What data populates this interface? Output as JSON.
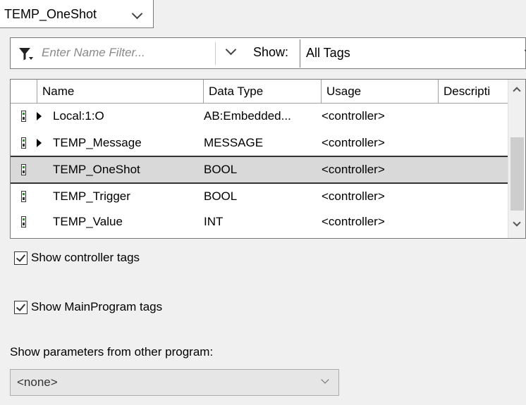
{
  "tag_combo": {
    "value": "TEMP_OneShot"
  },
  "filter": {
    "placeholder": "Enter Name Filter...",
    "show_label": "Show:",
    "show_value": "All Tags"
  },
  "grid": {
    "columns": [
      "Name",
      "Data Type",
      "Usage",
      "Descripti"
    ],
    "rows": [
      {
        "name": "Local:1:O",
        "type": "AB:Embedded...",
        "usage": "<controller>",
        "expandable": true,
        "selected": false
      },
      {
        "name": "TEMP_Message",
        "type": "MESSAGE",
        "usage": "<controller>",
        "expandable": true,
        "selected": false
      },
      {
        "name": "TEMP_OneShot",
        "type": "BOOL",
        "usage": "<controller>",
        "expandable": false,
        "selected": true
      },
      {
        "name": "TEMP_Trigger",
        "type": "BOOL",
        "usage": "<controller>",
        "expandable": false,
        "selected": false
      },
      {
        "name": "TEMP_Value",
        "type": "INT",
        "usage": "<controller>",
        "expandable": false,
        "selected": false
      }
    ]
  },
  "options": {
    "show_controller_tags": {
      "label": "Show controller tags",
      "checked": true
    },
    "show_mainprogram_tags": {
      "label": "Show MainProgram tags",
      "checked": true
    },
    "other_program_label": "Show parameters from other program:",
    "other_program_value": "<none>"
  },
  "colors": {
    "selected_row": "#d9d9d9",
    "tag_icon_green": "#2d8a2d",
    "background": "#f0f0f0"
  }
}
